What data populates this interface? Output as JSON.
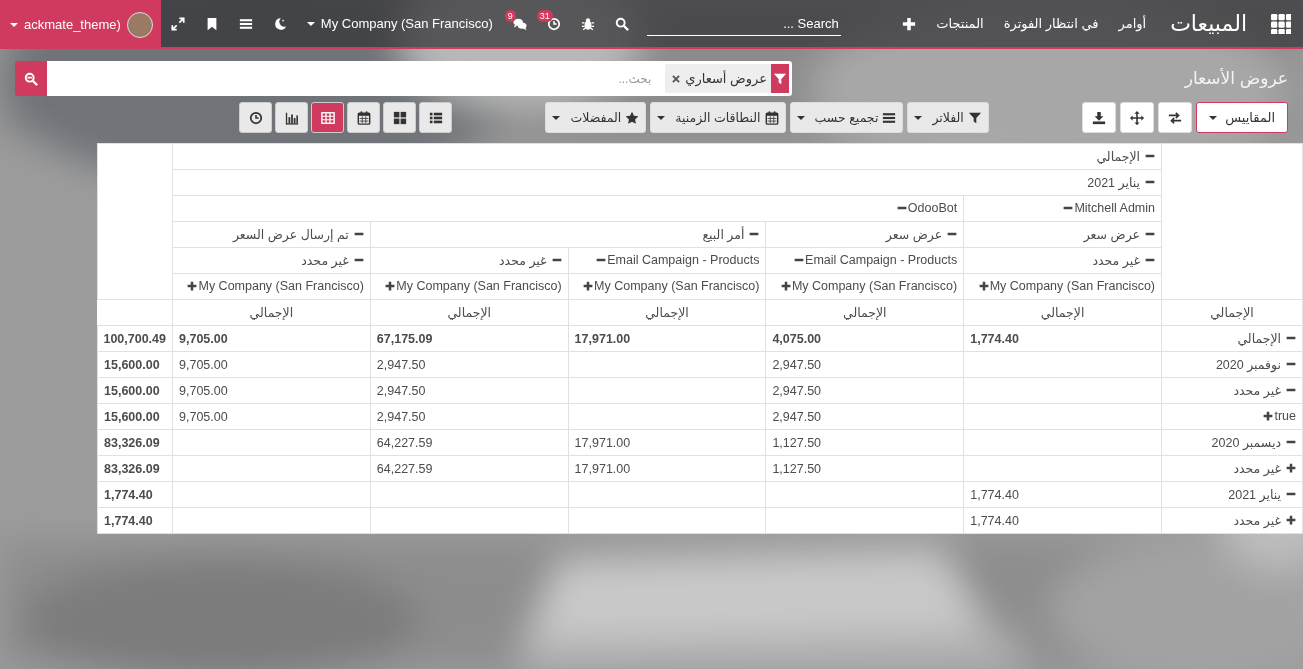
{
  "navbar": {
    "app_title": "المبيعات",
    "menus": [
      "أوامر",
      "في انتظار الفوترة",
      "المنتجات"
    ],
    "search": {
      "placeholder": "Search ..."
    },
    "messages_count": "9",
    "activities_count": "31",
    "company": "My Company (San Francisco)",
    "user": "ackmate_theme)"
  },
  "control_panel": {
    "breadcrumb": "عروض الأسعار",
    "search": {
      "facet": "عروض أسعاري",
      "placeholder": "بحث..."
    },
    "measures_button": "المقاييس",
    "filters": [
      {
        "kind": "filter",
        "label": "الفلاتر"
      },
      {
        "kind": "group",
        "label": "تجميع حسب"
      },
      {
        "kind": "date",
        "label": "النطاقات الزمنية"
      },
      {
        "kind": "favorite",
        "label": "المفضلات"
      }
    ],
    "views": [
      {
        "kind": "list",
        "selected": false
      },
      {
        "kind": "kanban",
        "selected": false
      },
      {
        "kind": "calendar",
        "selected": false
      },
      {
        "kind": "pivot",
        "selected": true
      },
      {
        "kind": "graph",
        "selected": false
      },
      {
        "kind": "activity",
        "selected": false
      }
    ]
  },
  "pivot": {
    "columns": [
      {
        "label": "الإجمالي",
        "expanded": true,
        "children": [
          {
            "label": "يناير 2021",
            "expanded": true,
            "children": [
              {
                "label": "Mitchell Admin",
                "expanded": true,
                "children": [
                  {
                    "label": "عرض سعر",
                    "expanded": true,
                    "children": [
                      {
                        "label": "غير محدد",
                        "expanded": true,
                        "children": [
                          {
                            "label": "My Company (San Francisco)",
                            "expanded": false
                          }
                        ]
                      }
                    ]
                  }
                ]
              },
              {
                "label": "OdooBot",
                "expanded": true,
                "children": [
                  {
                    "label": "عرض سعر",
                    "expanded": true,
                    "children": [
                      {
                        "label": "Email Campaign - Products",
                        "expanded": true,
                        "children": [
                          {
                            "label": "My Company (San Francisco)",
                            "expanded": false
                          }
                        ]
                      }
                    ]
                  },
                  {
                    "label": "أمر البيع",
                    "expanded": true,
                    "children": [
                      {
                        "label": "Email Campaign - Products",
                        "expanded": true,
                        "children": [
                          {
                            "label": "My Company (San Francisco)",
                            "expanded": false
                          }
                        ]
                      },
                      {
                        "label": "غير محدد",
                        "expanded": true,
                        "children": [
                          {
                            "label": "My Company (San Francisco)",
                            "expanded": false
                          }
                        ]
                      }
                    ]
                  },
                  {
                    "label": "تم إرسال عرض السعر",
                    "expanded": true,
                    "children": [
                      {
                        "label": "غير محدد",
                        "expanded": true,
                        "children": [
                          {
                            "label": "My Company (San Francisco)",
                            "expanded": false
                          }
                        ]
                      }
                    ]
                  }
                ]
              }
            ]
          }
        ]
      }
    ],
    "measure_headers": [
      "الإجمالي",
      "الإجمالي",
      "الإجمالي",
      "الإجمالي",
      "الإجمالي"
    ],
    "total_header": "الإجمالي",
    "rows": [
      {
        "label": "الإجمالي",
        "expanded": true,
        "values": {
          "col_1": "1,774.40",
          "col_2": "4,075.00",
          "col_3": "17,971.00",
          "col_4": "67,175.09",
          "col_5": "9,705.00"
        },
        "total": "100,700.49",
        "children": [
          {
            "label": "نوفمبر 2020",
            "expanded": true,
            "values": {
              "col_2": "2,947.50",
              "col_4": "2,947.50",
              "col_5": "9,705.00"
            },
            "total": "15,600.00",
            "children": [
              {
                "label": "غير محدد",
                "expanded": true,
                "values": {
                  "col_2": "2,947.50",
                  "col_4": "2,947.50",
                  "col_5": "9,705.00"
                },
                "total": "15,600.00",
                "children": [
                  {
                    "label": "true",
                    "expanded": false,
                    "values": {
                      "col_2": "2,947.50",
                      "col_4": "2,947.50",
                      "col_5": "9,705.00"
                    },
                    "total": "15,600.00"
                  }
                ]
              }
            ]
          },
          {
            "label": "ديسمبر 2020",
            "expanded": true,
            "values": {
              "col_2": "1,127.50",
              "col_3": "17,971.00",
              "col_4": "64,227.59"
            },
            "total": "83,326.09",
            "children": [
              {
                "label": "غير محدد",
                "expanded": false,
                "values": {
                  "col_2": "1,127.50",
                  "col_3": "17,971.00",
                  "col_4": "64,227.59"
                },
                "total": "83,326.09"
              }
            ]
          },
          {
            "label": "يناير 2021",
            "expanded": true,
            "values": {
              "col_1": "1,774.40"
            },
            "total": "1,774.40",
            "children": [
              {
                "label": "غير محدد",
                "expanded": false,
                "values": {
                  "col_1": "1,774.40"
                },
                "total": "1,774.40"
              }
            ]
          }
        ]
      }
    ]
  }
}
